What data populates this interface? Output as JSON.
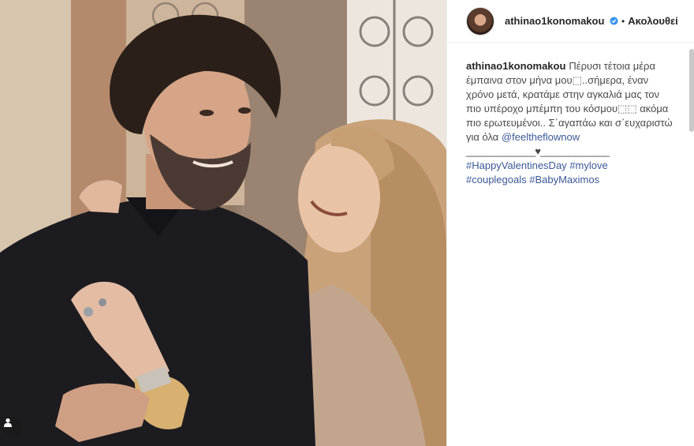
{
  "post": {
    "username": "athinao1konomakou",
    "separator": "•",
    "follow_label": "Ακολουθεί",
    "caption_user": "athinao1konomakou",
    "caption_text": "Πέρυσι τέτοια μέρα έμπαινα στον μήνα μου⬚..σήμερα, έναν χρόνο μετά, κρατάμε στην αγκαλιά μας τον πιο υπέροχο μπέμπη του κόσμου⬚⬚ ακόμα πιο ερωτευμένοι.. Σ΄αγαπάω και σ΄ευχαριστώ για όλα",
    "mention": "@feeltheflownow",
    "divider": "______________♥______________",
    "hashtags_line1": "#HappyValentinesDay #mylove",
    "hashtags_line2": "#couplegoals #BabyMaximos"
  },
  "icons": {
    "verified": "verified-badge-icon",
    "user_tag": "user-tag-icon"
  },
  "colors": {
    "hashtag_link": "#3b5998",
    "text": "#262626",
    "verified_blue": "#3897f0"
  }
}
